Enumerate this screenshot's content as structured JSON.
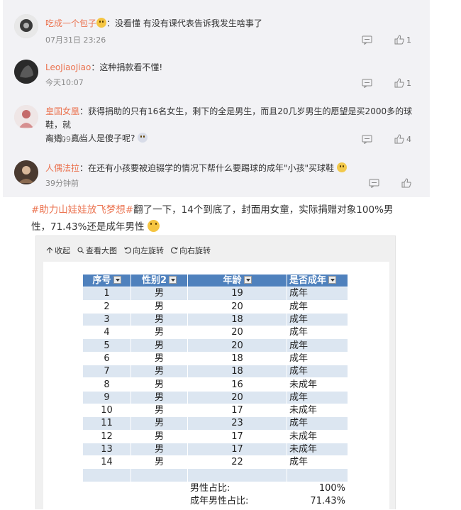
{
  "comments": [
    {
      "username": "吃成一个包子",
      "text": "：没看懂 有没有课代表告诉我发生啥事了",
      "time": "07月31日 23:26",
      "likes": "1"
    },
    {
      "username": "LeoJiaoJiao",
      "text": "：这种捐款看不懂!",
      "time": "今天10:07",
      "likes": "1"
    },
    {
      "username": "皇国女凰",
      "text": "：获得捐助的只有16名女生，剩下的全是男生，而且20几岁男生的愿望是买2000多的球鞋，就",
      "text2": "离谱，真当人是傻子呢?",
      "time": "今天09:06",
      "likes": "4"
    },
    {
      "username": "人偶法拉",
      "text": "：在还有小孩要被迫辍学的情况下帮什么要踢球的成年\"小孩\"买球鞋",
      "time": "39分钟前",
      "likes": ""
    }
  ],
  "post": {
    "hashtag": "#助力山娃娃放飞梦想#",
    "text": "翻了一下，14个到底了，封面用女童，实际捐赠对象100%男",
    "text2": "性，71.43%还是成年男性"
  },
  "toolbar": {
    "collapse": "收起",
    "view_large": "查看大图",
    "rotate_left": "向左旋转",
    "rotate_right": "向右旋转"
  },
  "chart_data": {
    "type": "table",
    "columns": [
      "序号",
      "性别2",
      "年龄",
      "是否成年"
    ],
    "rows": [
      [
        "1",
        "男",
        "19",
        "成年"
      ],
      [
        "2",
        "男",
        "20",
        "成年"
      ],
      [
        "3",
        "男",
        "18",
        "成年"
      ],
      [
        "4",
        "男",
        "20",
        "成年"
      ],
      [
        "5",
        "男",
        "20",
        "成年"
      ],
      [
        "6",
        "男",
        "18",
        "成年"
      ],
      [
        "7",
        "男",
        "18",
        "成年"
      ],
      [
        "8",
        "男",
        "16",
        "未成年"
      ],
      [
        "9",
        "男",
        "20",
        "成年"
      ],
      [
        "10",
        "男",
        "17",
        "未成年"
      ],
      [
        "11",
        "男",
        "23",
        "成年"
      ],
      [
        "12",
        "男",
        "17",
        "未成年"
      ],
      [
        "13",
        "男",
        "17",
        "未成年"
      ],
      [
        "14",
        "男",
        "22",
        "成年"
      ]
    ],
    "summary": [
      {
        "label": "男性占比:",
        "value": "100%"
      },
      {
        "label": "成年男性占比:",
        "value": "71.43%"
      }
    ]
  }
}
